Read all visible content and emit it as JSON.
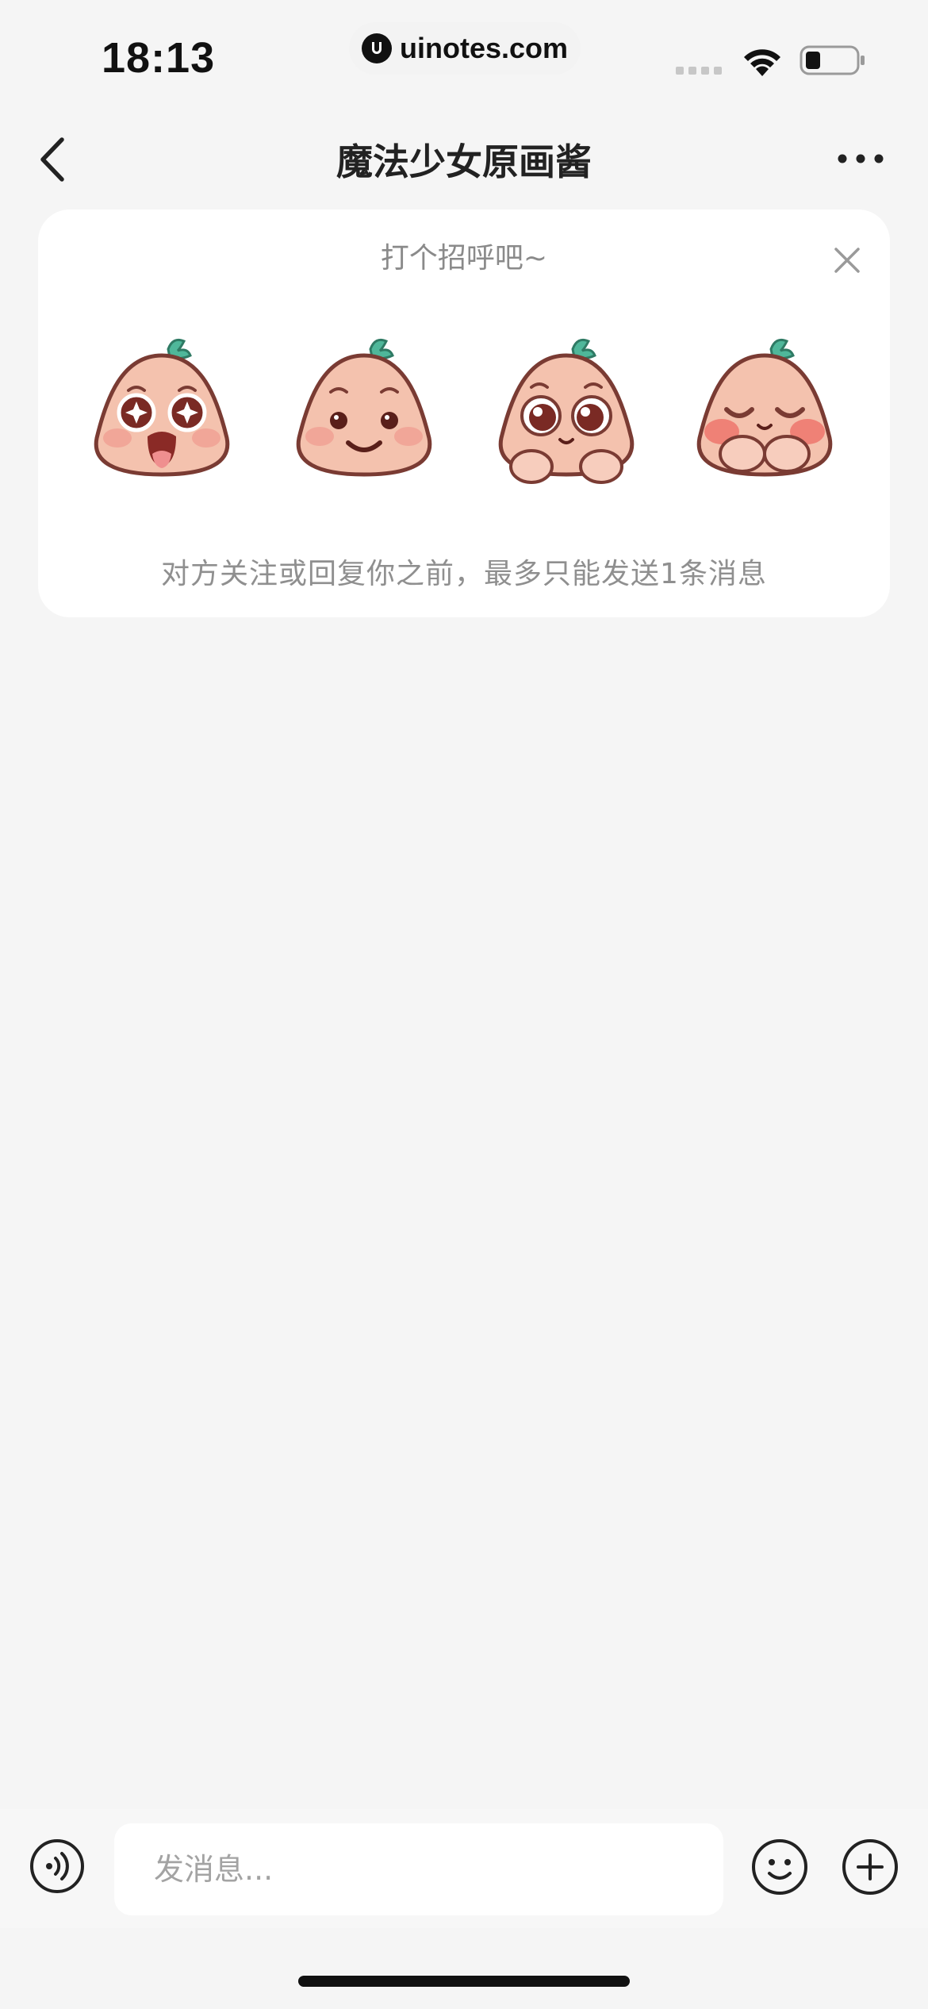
{
  "status_bar": {
    "time": "18:13",
    "url": "uinotes.com",
    "icons": [
      "signal-icon",
      "wifi-icon",
      "battery-icon"
    ]
  },
  "nav": {
    "title": "魔法少女原画酱",
    "back_icon": "chevron-left-icon",
    "more_icon": "more-dots-icon"
  },
  "greeting": {
    "title": "打个招呼吧~",
    "close_icon": "close-icon",
    "stickers": [
      {
        "name": "peach-excited-sticker"
      },
      {
        "name": "peach-smile-sticker"
      },
      {
        "name": "peach-shy-eyes-sticker"
      },
      {
        "name": "peach-blush-sticker"
      }
    ],
    "note": "对方关注或回复你之前，最多只能发送1条消息"
  },
  "input_bar": {
    "placeholder": "发消息...",
    "value": "",
    "voice_icon": "voice-icon",
    "emoji_icon": "emoji-icon",
    "plus_icon": "plus-icon"
  },
  "colors": {
    "background": "#f5f5f5",
    "card": "#ffffff",
    "title_text": "#222222",
    "muted_text": "#8a8a8a",
    "peach": "#f4c2ae",
    "peach_outline": "#7a3b33",
    "leaf": "#4fb79a"
  }
}
